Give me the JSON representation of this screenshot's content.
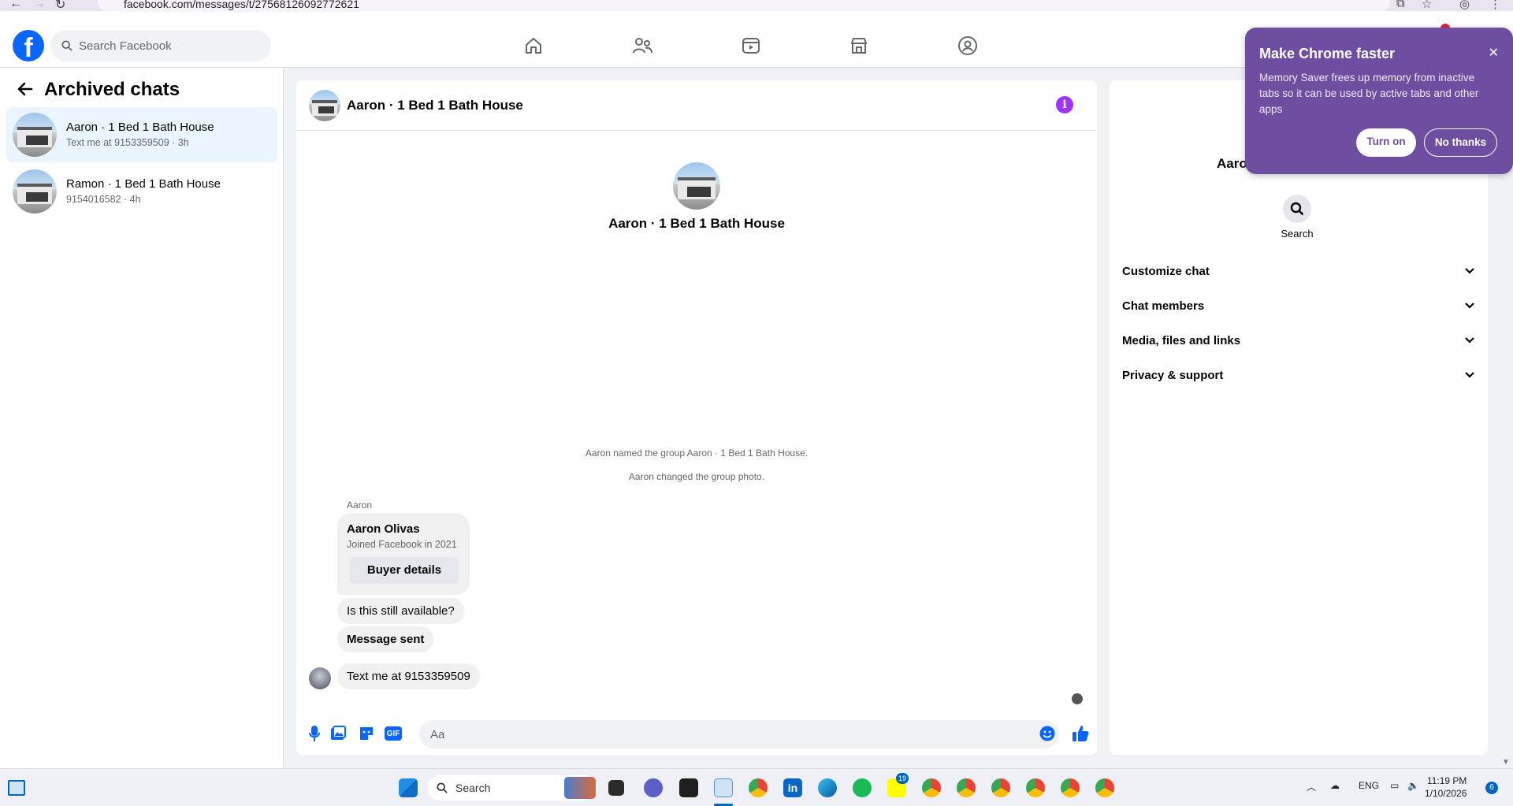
{
  "browser": {
    "url": "facebook.com/messages/t/27568126092772621"
  },
  "header": {
    "search_placeholder": "Search Facebook"
  },
  "sidebar": {
    "title": "Archived chats",
    "chats": [
      {
        "name": "Aaron · 1 Bed 1 Bath House",
        "preview": "Text me at 9153359509 · 3h"
      },
      {
        "name": "Ramon · 1 Bed 1 Bath House",
        "preview": "9154016582 · 4h"
      }
    ]
  },
  "chat": {
    "title": "Aaron · 1 Bed 1 Bath House",
    "center_title": "Aaron · 1 Bed 1 Bath House",
    "system_messages": [
      "Aaron named the group Aaron · 1 Bed 1 Bath House.",
      "Aaron changed the group photo."
    ],
    "sender_label": "Aaron",
    "card": {
      "name": "Aaron Olivas",
      "joined": "Joined Facebook in 2021",
      "button": "Buyer details"
    },
    "messages": [
      "Is this still available?",
      "Message sent",
      "Text me at 9153359509"
    ],
    "composer_placeholder": "Aa",
    "gif_label": "GIF"
  },
  "details": {
    "name": "Aaro",
    "search_label": "Search",
    "sections": [
      "Customize chat",
      "Chat members",
      "Media, files and links",
      "Privacy & support"
    ]
  },
  "chrome_popup": {
    "title": "Make Chrome faster",
    "body": "Memory Saver frees up memory from inactive tabs so it can be used by active tabs and other apps",
    "turn_on": "Turn on",
    "no_thanks": "No thanks"
  },
  "taskbar": {
    "search_label": "Search",
    "language": "ENG",
    "time": "11:19 PM",
    "date": "1/10/2026",
    "notification_count": "6",
    "badge_count": "19"
  },
  "colors": {
    "fb_blue": "#0866ff",
    "messenger_purple": "#a033ff",
    "popup_purple": "#6e4ea0",
    "active_chat_bg": "#ebf5ff"
  }
}
